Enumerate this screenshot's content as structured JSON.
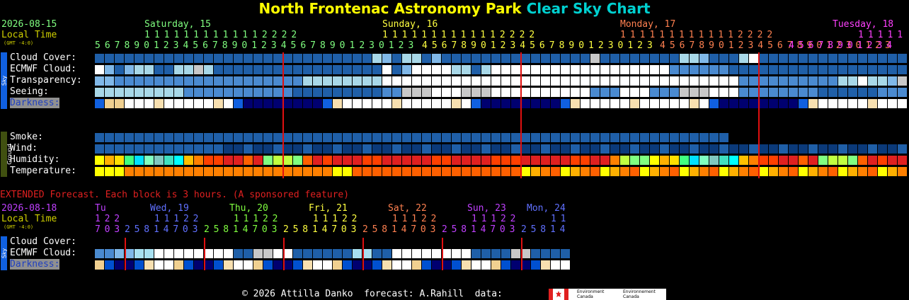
{
  "title": {
    "part1": "North Frontenac Astronomy Park",
    "part2": "Clear Sky Chart"
  },
  "colors": {
    "title_yellow": "#ffff00",
    "title_cyan": "#00d0d0",
    "date": "#80ff80",
    "local": "#d0d000",
    "label": "#ffffff",
    "extended": "#e02020",
    "vline": "#e01010"
  },
  "main": {
    "date": "2026-08-15",
    "local_time": "Local Time",
    "gmt": "(GMT -4:0)",
    "days": [
      {
        "label": "Saturday, 15",
        "color": "#80ff80"
      },
      {
        "label": "Sunday, 16",
        "color": "#ffff40"
      },
      {
        "label": "Monday, 17",
        "color": "#ff8050"
      },
      {
        "label": "Tuesday, 18",
        "color": "#ff40ff"
      }
    ],
    "tens_row": [
      {
        "text": "1111111111112222",
        "color": "#80ff80"
      },
      {
        "text": "1111111111112222",
        "color": "#ffff40"
      },
      {
        "text": "1111111111112222",
        "color": "#ff8050"
      },
      {
        "text": "11111",
        "color": "#ff40ff"
      }
    ],
    "ones_row": [
      {
        "text": "567890123456789012345678901230123",
        "color": "#80ff80"
      },
      {
        "text": "456789012345678901230123",
        "color": "#ffff40"
      },
      {
        "text": "456789012345678901230123",
        "color": "#ff8050"
      },
      {
        "text": "45678901234",
        "color": "#ff40ff"
      }
    ],
    "sky_tab": "Sky",
    "ground_tab": "Ground",
    "sky_rows": [
      {
        "label": "Cloud Cover:",
        "cells": "CCCCCCCCCCCCCCCCCCCCCCCCCCCCCCCCCCCCCCCCCCCCCCCCCCCCCCCCCCCCCCCCCCCCCCCCCCCCCCCCCCCCCCCCCCCCCCCCCCCCCCCCCCCCCCCCCCCCCCCCCCCCCCCCCCCCCCCCCCCCCCCCCCCCCCCCCCCCCCCC",
        "pattern": "cloud"
      },
      {
        "label": "ECMWF Cloud:",
        "pattern": "ecmwf"
      },
      {
        "label": "Transparency:",
        "pattern": "transp"
      },
      {
        "label": "Seeing:",
        "pattern": "seeing"
      },
      {
        "label": "Darkness:",
        "pattern": "dark"
      }
    ],
    "ground_rows": [
      {
        "label": "Smoke:",
        "pattern": "smoke"
      },
      {
        "label": "Wind:",
        "pattern": "wind"
      },
      {
        "label": "Humidity:",
        "pattern": "humid"
      },
      {
        "label": "Temperature:",
        "pattern": "temp"
      }
    ]
  },
  "extended": {
    "heading": "EXTENDED Forecast. Each block is 3 hours. (A sponsored feature)",
    "date": "2026-08-18",
    "local_time": "Local Time",
    "gmt": "(GMT -4:0)",
    "days": [
      {
        "label": "Tu",
        "color": "#c040ff"
      },
      {
        "label": "Wed, 19",
        "color": "#6070ff"
      },
      {
        "label": "Thu, 20",
        "color": "#80ff40"
      },
      {
        "label": "Fri, 21",
        "color": "#ffff40"
      },
      {
        "label": "Sat, 22",
        "color": "#ff8050"
      },
      {
        "label": "Sun, 23",
        "color": "#c040ff"
      },
      {
        "label": "Mon, 24",
        "color": "#6070ff"
      }
    ],
    "tens": [
      "1 2 2",
      "1 1 1 2 2",
      "1 1 1 2 2",
      "1 1 1 2 2",
      "1 1 1 2 2",
      "1 1 1 2 2",
      "1 1"
    ],
    "ones": [
      "7 0 3",
      "2 5 8 1 4 7 0 3",
      "2 5 8 1 4 7 0 3",
      "2 5 8 1 4 7 0 3",
      "2 5 8 1 4 7 0 3",
      "2 5 8 1 4 7 0 3",
      "2 5 8 1 4"
    ],
    "rows": [
      {
        "label": "Cloud Cover:"
      },
      {
        "label": "ECMWF Cloud:"
      },
      {
        "label": "Darkness:"
      }
    ]
  },
  "footer": {
    "text": "© 2026 Attilla Danko  forecast: A.Rahill  data:",
    "flag1_text": "Environment Canada",
    "flag2_text": "Environnement Canada"
  }
}
